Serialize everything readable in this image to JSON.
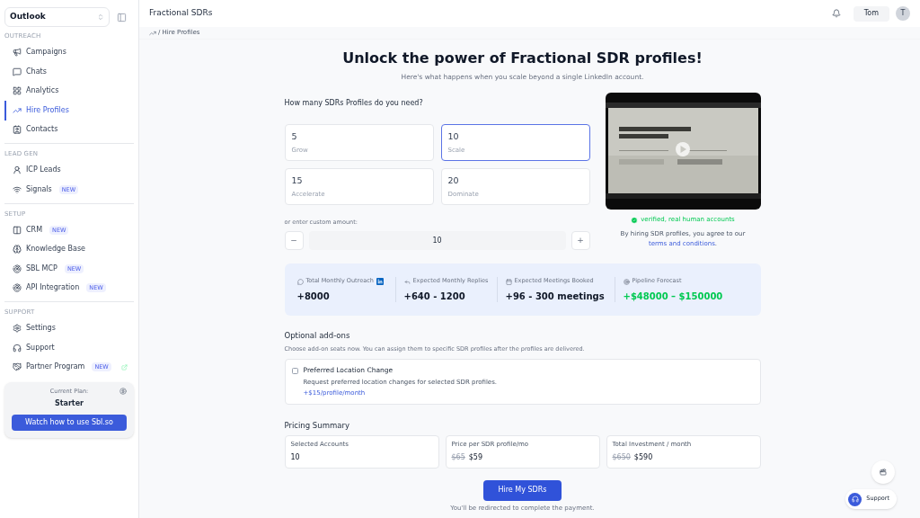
{
  "sidebar": {
    "workspace": "Outlook",
    "sections": [
      {
        "title": "OUTREACH",
        "items": [
          {
            "label": "Campaigns",
            "selected": false
          },
          {
            "label": "Chats",
            "selected": false
          },
          {
            "label": "Analytics",
            "selected": false
          },
          {
            "label": "Hire Profiles",
            "selected": true
          },
          {
            "label": "Contacts",
            "selected": false
          }
        ]
      },
      {
        "title": "LEAD GEN",
        "items": [
          {
            "label": "ICP Leads",
            "selected": false
          },
          {
            "label": "Signals",
            "selected": false,
            "badge": "NEW"
          }
        ]
      },
      {
        "title": "SETUP",
        "items": [
          {
            "label": "CRM",
            "selected": false,
            "badge": "NEW"
          },
          {
            "label": "Knowledge Base",
            "selected": false
          },
          {
            "label": "SBL MCP",
            "selected": false,
            "badge": "NEW"
          },
          {
            "label": "API Integration",
            "selected": false,
            "badge": "NEW"
          }
        ]
      },
      {
        "title": "SUPPORT",
        "items": [
          {
            "label": "Settings",
            "selected": false
          },
          {
            "label": "Support",
            "selected": false
          },
          {
            "label": "Partner Program",
            "selected": false,
            "badge": "NEW",
            "external": true
          }
        ]
      }
    ],
    "plan": {
      "label": "Current Plan:",
      "name": "Starter",
      "button": "Watch how to use Sbl.so"
    }
  },
  "header": {
    "title": "Fractional SDRs",
    "user": "Tom",
    "avatar": "T"
  },
  "breadcrumb": "/ Hire Profiles",
  "hero": {
    "title": "Unlock the power of Fractional SDR profiles!",
    "subtitle": "Here's what happens when you scale beyond a single LinkedIn account."
  },
  "selector": {
    "question": "How many SDRs Profiles do you need?",
    "options": [
      {
        "count": "5",
        "name": "Grow",
        "selected": false
      },
      {
        "count": "10",
        "name": "Scale",
        "selected": true
      },
      {
        "count": "15",
        "name": "Accelerate",
        "selected": false
      },
      {
        "count": "20",
        "name": "Dominate",
        "selected": false
      }
    ],
    "custom_label": "or enter custom amount:",
    "minus": "−",
    "value": "10",
    "plus": "+"
  },
  "video": {
    "verified": "verified, real human accounts",
    "terms_prefix": "By hiring SDR profiles, you agree to our",
    "terms_link": "terms and conditions",
    "terms_suffix": "."
  },
  "stats": [
    {
      "label": "Total Monthly Outreach",
      "value": "+8000",
      "kind": "plain",
      "linkedin": true
    },
    {
      "label": "Expected Monthly Replies",
      "value": "+640 - 1200",
      "kind": "plain"
    },
    {
      "label": "Expected Meetings Booked",
      "value": "+96 - 300 meetings",
      "kind": "plain"
    },
    {
      "label": "Pipeline Forecast",
      "value": "+$48000 – $150000",
      "kind": "positive"
    }
  ],
  "addons": {
    "title": "Optional add-ons",
    "description": "Choose add-on seats now. You can assign them to specific SDR profiles after the profiles are delivered.",
    "items": [
      {
        "title": "Preferred Location Change",
        "description": "Request preferred location changes for selected SDR profiles.",
        "price": "+$15/profile/month",
        "checked": false
      }
    ]
  },
  "pricing": {
    "title": "Pricing Summary",
    "cards": [
      {
        "label": "Selected Accounts",
        "value": "10"
      },
      {
        "label": "Price per SDR profile/mo",
        "old_value": "$65",
        "value": "$59"
      },
      {
        "label": "Total Investment / month",
        "old_value": "$650",
        "value": "$590"
      }
    ]
  },
  "cta": {
    "button": "Hire My SDRs",
    "note": "You'll be redirected to complete the payment."
  },
  "support_widget": {
    "label": "Support"
  }
}
